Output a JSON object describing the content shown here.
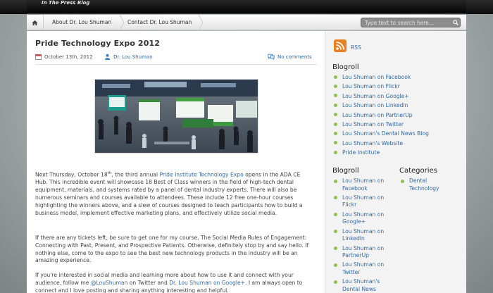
{
  "header": {
    "site_tag": "In The Press Blog"
  },
  "nav": {
    "items": [
      "About Dr. Lou Shuman",
      "Contact Dr. Lou Shuman"
    ]
  },
  "search": {
    "placeholder": "Type text to search here..."
  },
  "post": {
    "title": "Pride Technology Expo 2012",
    "date": "October 13th, 2012",
    "author": "Dr. Lou Shuman",
    "comments": "No comments",
    "p1_pre": "Next Thursday, October 18",
    "p1_sup": "th",
    "p1_mid": ", the third annual ",
    "p1_link": "Pride Institute Technology Expo",
    "p1_post": " opens in the ADA CE Hub. This incredible event will showcase 18 Best of Class winners in the field of high-tech dental equipment, materials, and systems rated by a panel of dental industry experts. There will also be numerous seminars and courses available to attendees. These include 12 free one-hour courses highlighting the winners above, and a slew of courses designed to teach participants how to build a business model, implement effective marketing plans, and effectively utilize social media.",
    "p2": "If there are any tickets left, be sure to get one for my course, The Social Media Rules of Engagement: Connecting with Past, Present, and Prospective Patients. Otherwise, definitely stop by and say hello. If nothing else, come to the expo to see the best new technology products in the industry will be an amazing experience.",
    "p3_pre": "If you're interested in social media and learning more about how to use it and connect with your audience, follow me ",
    "p3_link1": "@LouShuman",
    "p3_mid": " on Twitter and ",
    "p3_link2": "Dr. Lou Shuman on Google+",
    "p3_post": ". I am always open to connect and I love posting and sharing anything interesting and helpful."
  },
  "sidebar": {
    "rss_label": "RSS",
    "blogroll1_title": "Blogroll",
    "blogroll1": [
      "Lou Shuman on Facebook",
      "Lou Shuman on Flickr",
      "Lou Shuman on Google+",
      "Lou Shuman on LinkedIn",
      "Lou Shuman on PartnerUp",
      "Lou Shuman on Twitter",
      "Lou Shuman's Dental News Blog",
      "Lou Shuman's Website",
      "Pride Institute"
    ],
    "blogroll2_title": "Blogroll",
    "blogroll2": [
      "Lou Shuman on Facebook",
      "Lou Shuman on Flickr",
      "Lou Shuman on Google+",
      "Lou Shuman on LinkedIn",
      "Lou Shuman on PartnerUp",
      "Lou Shuman on Twitter",
      "Lou Shuman's Dental News"
    ],
    "categories_title": "Categories",
    "categories": [
      "Dental Technology"
    ]
  }
}
